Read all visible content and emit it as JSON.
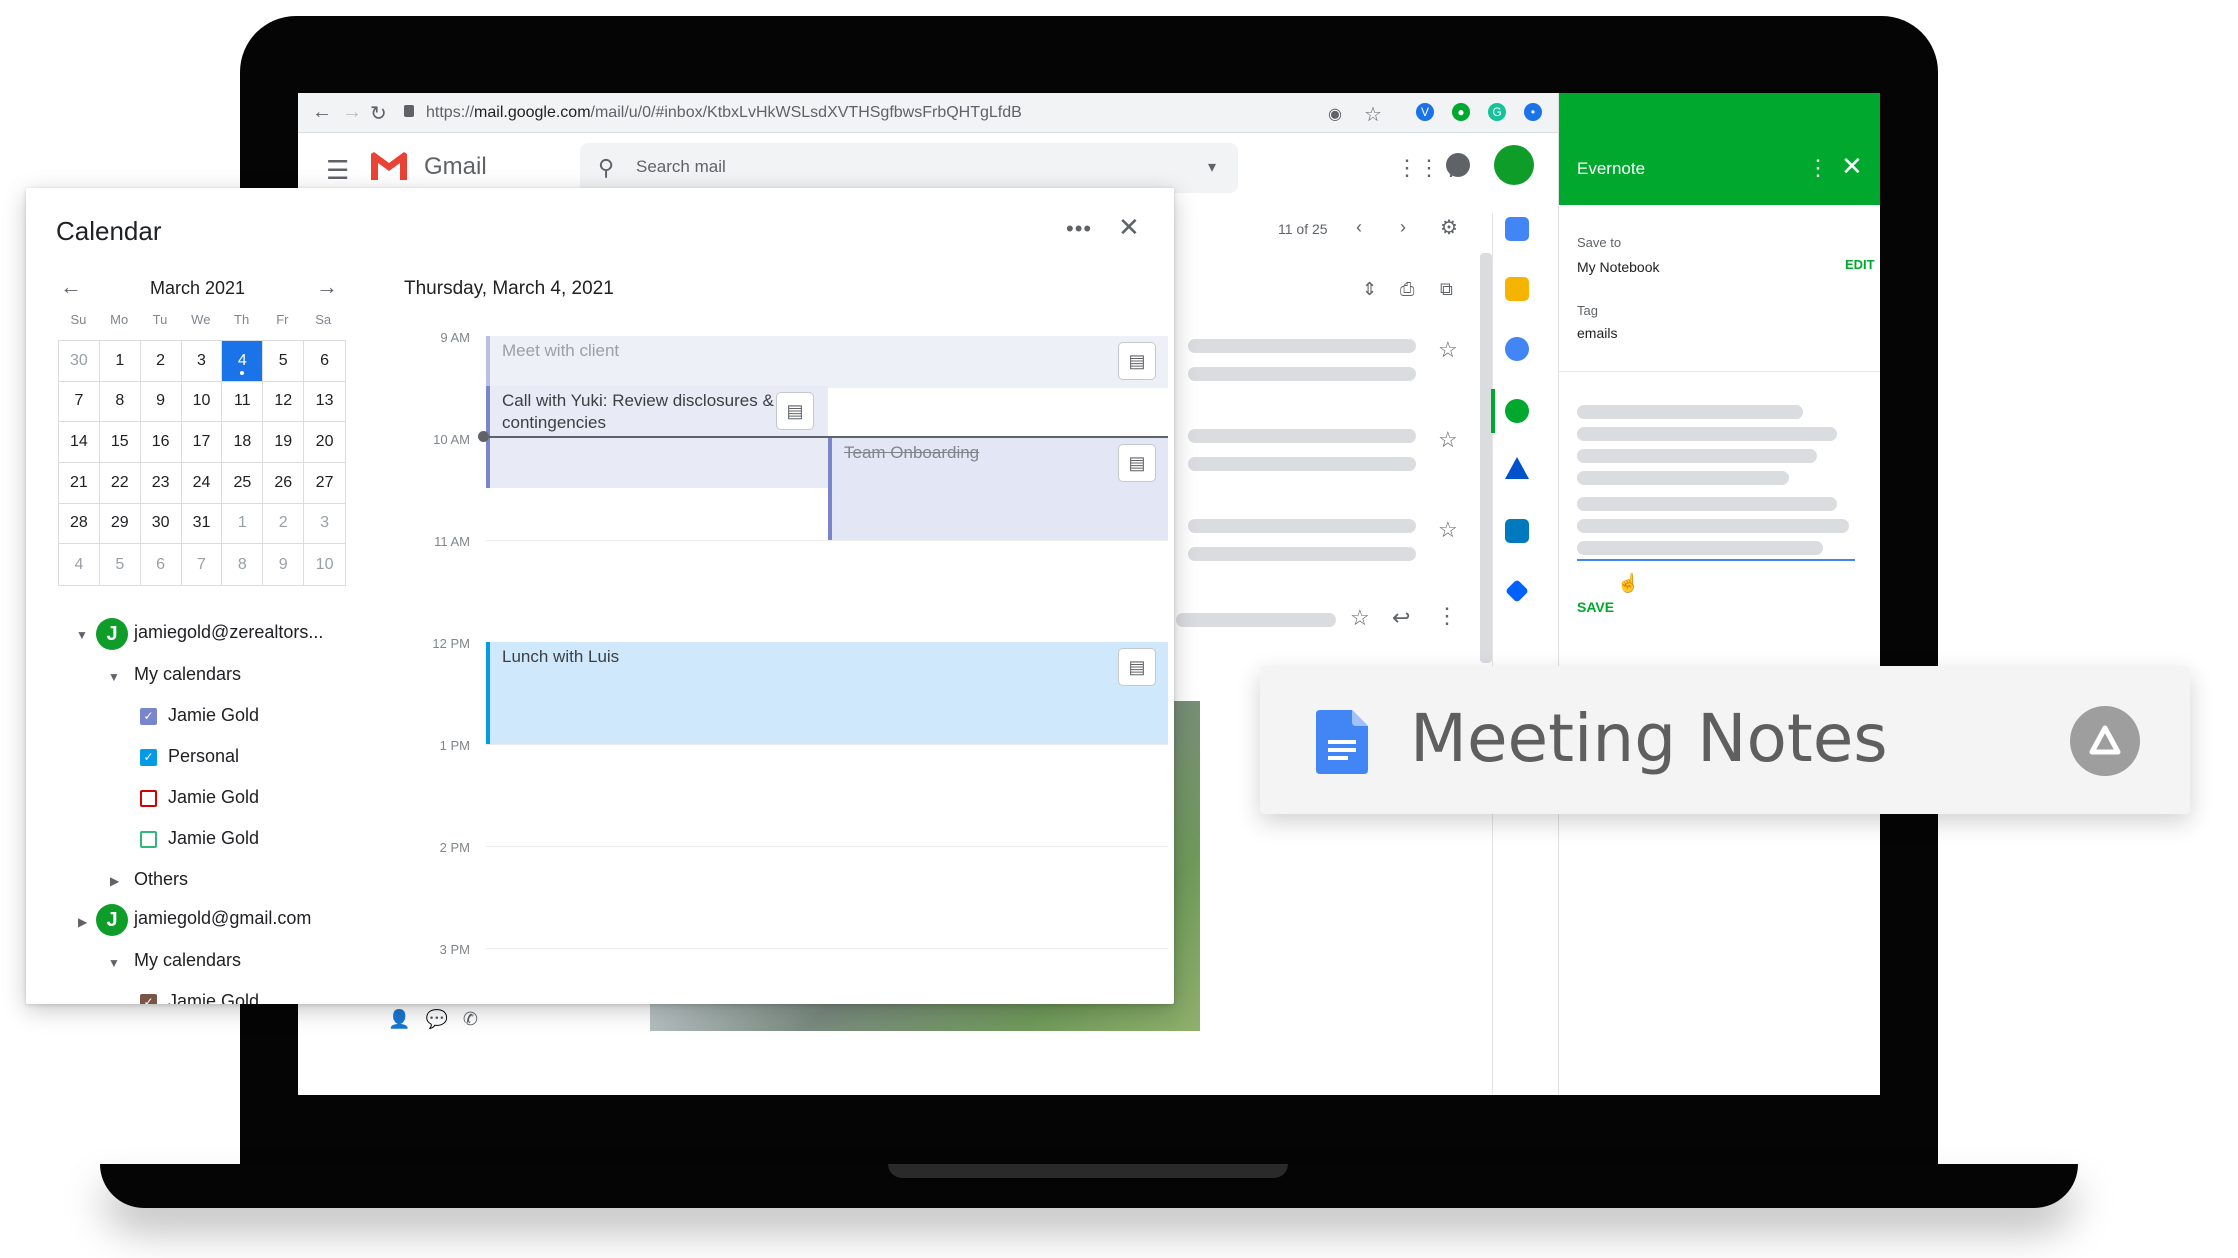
{
  "browser": {
    "url_prefix": "https://",
    "url_domain": "mail.google.com",
    "url_path": "/mail/u/0/#inbox/KtbxLvHkWSLsdXVTHSgfbwsFrbQHTgLfdB",
    "ext_f": "ƒ?"
  },
  "gmail": {
    "title": "Gmail",
    "search_placeholder": "Search mail",
    "pagination": "11 of 25"
  },
  "evernote": {
    "title": "Evernote",
    "save_to_label": "Save to",
    "save_to_value": "My Notebook",
    "edit_label": "EDIT",
    "tag_label": "Tag",
    "tag_value": "emails",
    "save_label": "SAVE",
    "accent": "#00a82d"
  },
  "calendar": {
    "title": "Calendar",
    "mini_month": "March 2021",
    "dow": [
      "Su",
      "Mo",
      "Tu",
      "We",
      "Th",
      "Fr",
      "Sa"
    ],
    "weeks": [
      [
        "30",
        "1",
        "2",
        "3",
        "4",
        "5",
        "6"
      ],
      [
        "7",
        "8",
        "9",
        "10",
        "11",
        "12",
        "13"
      ],
      [
        "14",
        "15",
        "16",
        "17",
        "18",
        "19",
        "20"
      ],
      [
        "21",
        "22",
        "23",
        "24",
        "25",
        "26",
        "27"
      ],
      [
        "28",
        "29",
        "30",
        "31",
        "1",
        "2",
        "3"
      ],
      [
        "4",
        "5",
        "6",
        "7",
        "8",
        "9",
        "10"
      ]
    ],
    "selected_day": "4",
    "day_title": "Thursday, March 4, 2021",
    "hours": [
      "9 AM",
      "10 AM",
      "11 AM",
      "12 PM",
      "1 PM",
      "2 PM",
      "3 PM"
    ],
    "accounts": [
      {
        "avatar": "J",
        "email": "jamiegold@zerealtors..."
      },
      {
        "avatar": "J",
        "email": "jamiegold@gmail.com"
      }
    ],
    "my_calendars_label": "My calendars",
    "others_label": "Others",
    "calendars": [
      {
        "name": "Jamie Gold",
        "color": "#7986cb",
        "checked": true
      },
      {
        "name": "Personal",
        "color": "#039be5",
        "checked": true
      },
      {
        "name": "Jamie Gold",
        "color": "#d50000",
        "checked": false
      },
      {
        "name": "Jamie Gold",
        "color": "#33b679",
        "checked": false
      },
      {
        "name": "Jamie Gold",
        "color": "#795548",
        "checked": true
      }
    ],
    "events": {
      "meet": "Meet with client",
      "yuki": "Call with Yuki: Review disclosures & contingencies",
      "onboarding": "Team Onboarding",
      "lunch": "Lunch with Luis"
    }
  },
  "meeting_notes": {
    "title": "Meeting Notes"
  }
}
